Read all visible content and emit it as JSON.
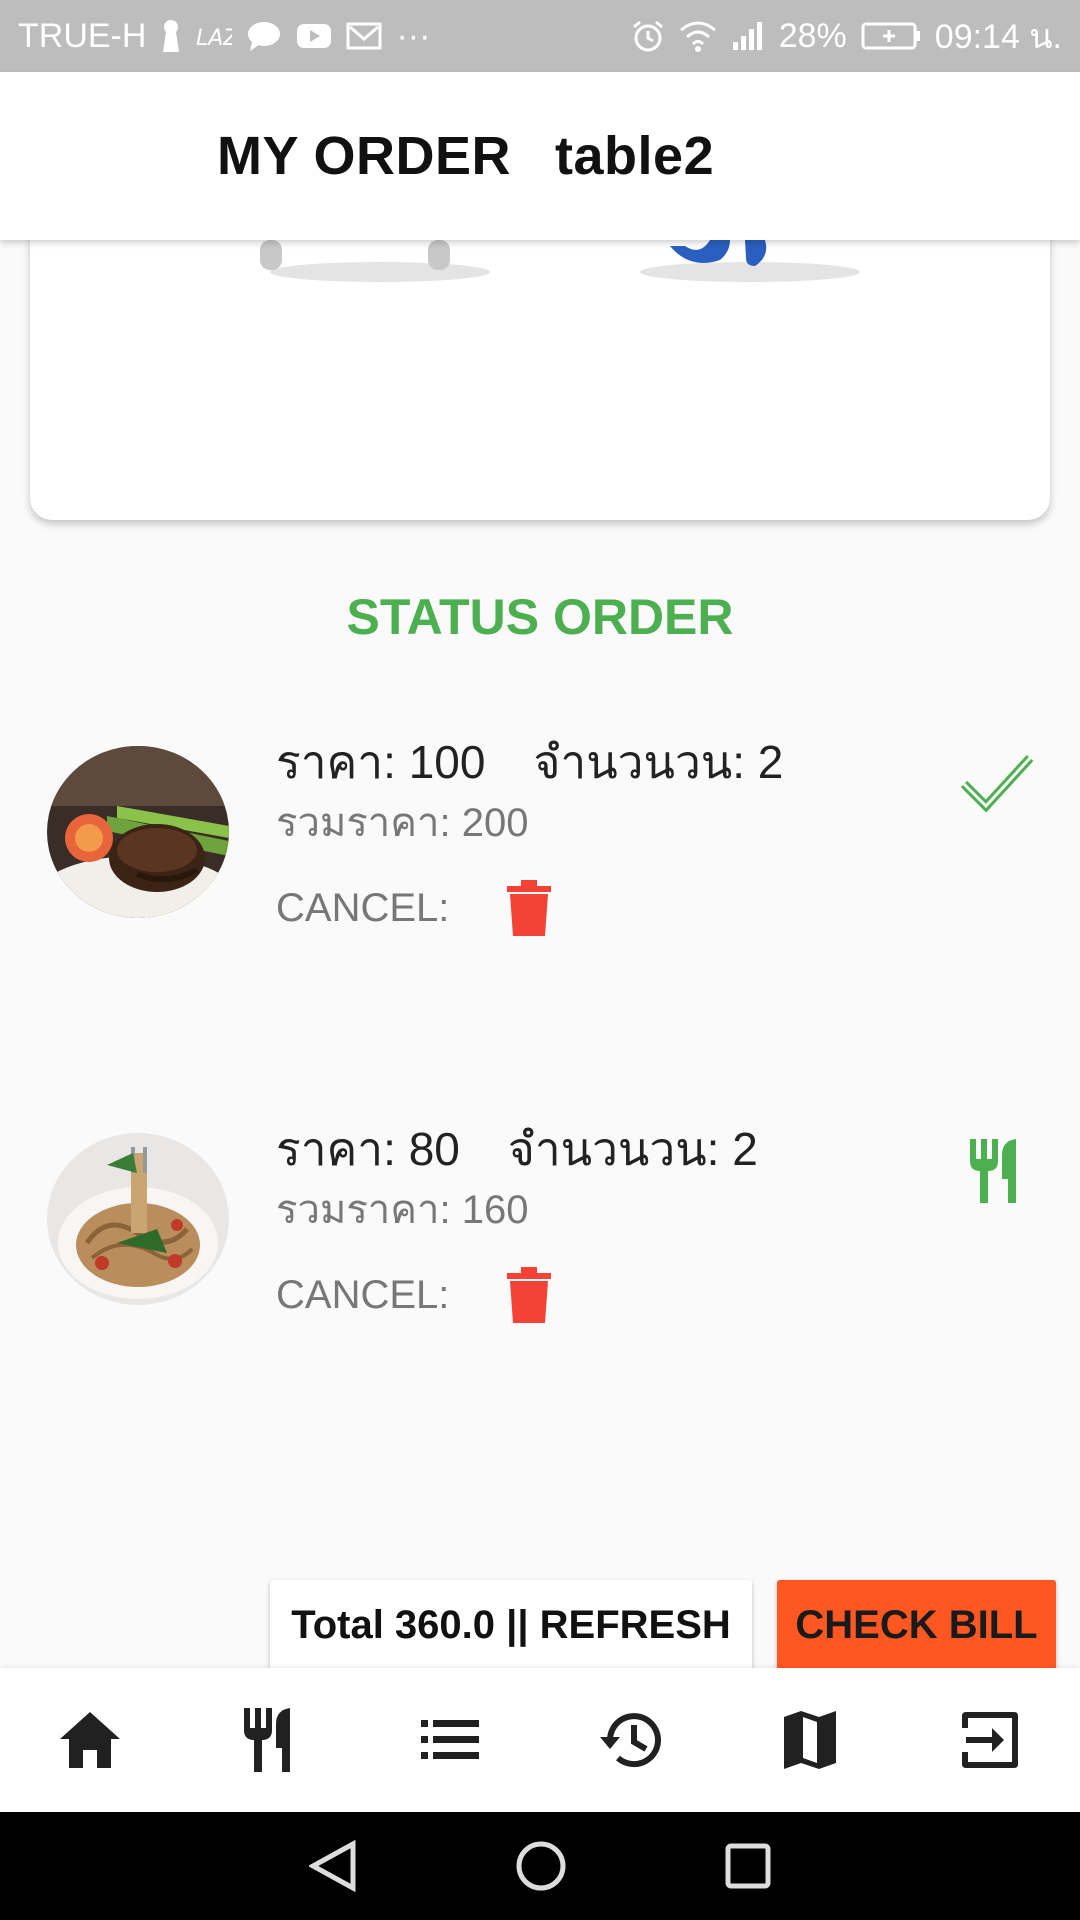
{
  "status_bar": {
    "carrier": "TRUE-H",
    "battery_percent": "28%",
    "time": "09:14 น."
  },
  "app_bar": {
    "title": "MY ORDER",
    "table": "table2"
  },
  "status_section": {
    "title": "STATUS ORDER"
  },
  "orders": [
    {
      "price_text": "ราคา: 100",
      "qty_text": "จำนวนวน: 2",
      "total_text": "รวมราคา: 200",
      "cancel_label": "CANCEL:",
      "status_icon": "check-icon"
    },
    {
      "price_text": "ราคา: 80",
      "qty_text": "จำนวนวน: 2",
      "total_text": "รวมราคา: 160",
      "cancel_label": "CANCEL:",
      "status_icon": "cutlery-icon"
    }
  ],
  "actions": {
    "total_refresh_label": "Total 360.0 || REFRESH",
    "check_bill_label": "CHECK BILL"
  },
  "bottom_nav": [
    "home-icon",
    "cutlery-icon",
    "list-icon",
    "history-icon",
    "map-icon",
    "exit-icon"
  ],
  "colors": {
    "accent_green": "#4caf50",
    "delete_red": "#f44336",
    "check_bill": "#ff5722"
  }
}
